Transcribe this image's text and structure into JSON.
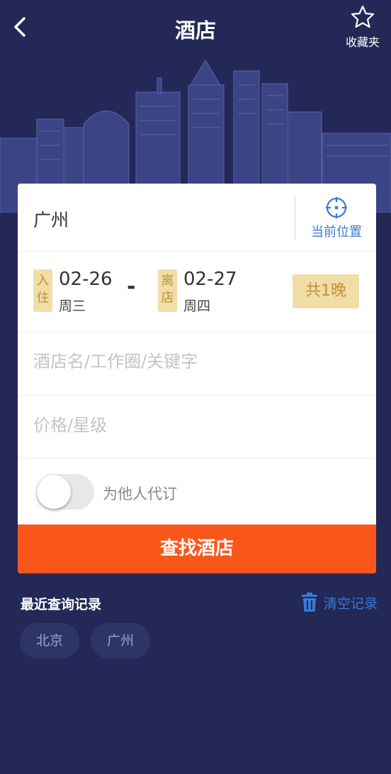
{
  "header": {
    "title": "酒店",
    "favorites_label": "收藏夹"
  },
  "search": {
    "city": "广州",
    "locate_label": "当前位置",
    "checkin": {
      "tag": "入住",
      "date": "02-26",
      "weekday": "周三"
    },
    "checkout": {
      "tag": "离店",
      "date": "02-27",
      "weekday": "周四"
    },
    "dash": "-",
    "nights": "共1晚",
    "keyword_placeholder": "酒店名/工作圈/关键字",
    "price_placeholder": "价格/星级",
    "book_for_others_label": "为他人代订",
    "book_for_others_on": false,
    "submit_label": "查找酒店"
  },
  "history": {
    "title": "最近查询记录",
    "clear_label": "清空记录",
    "items": [
      "北京",
      "广州"
    ]
  },
  "colors": {
    "background": "#232856",
    "accent_orange": "#fb5619",
    "link_blue": "#3a7bd5",
    "tag_gold": "#f1dda6"
  }
}
